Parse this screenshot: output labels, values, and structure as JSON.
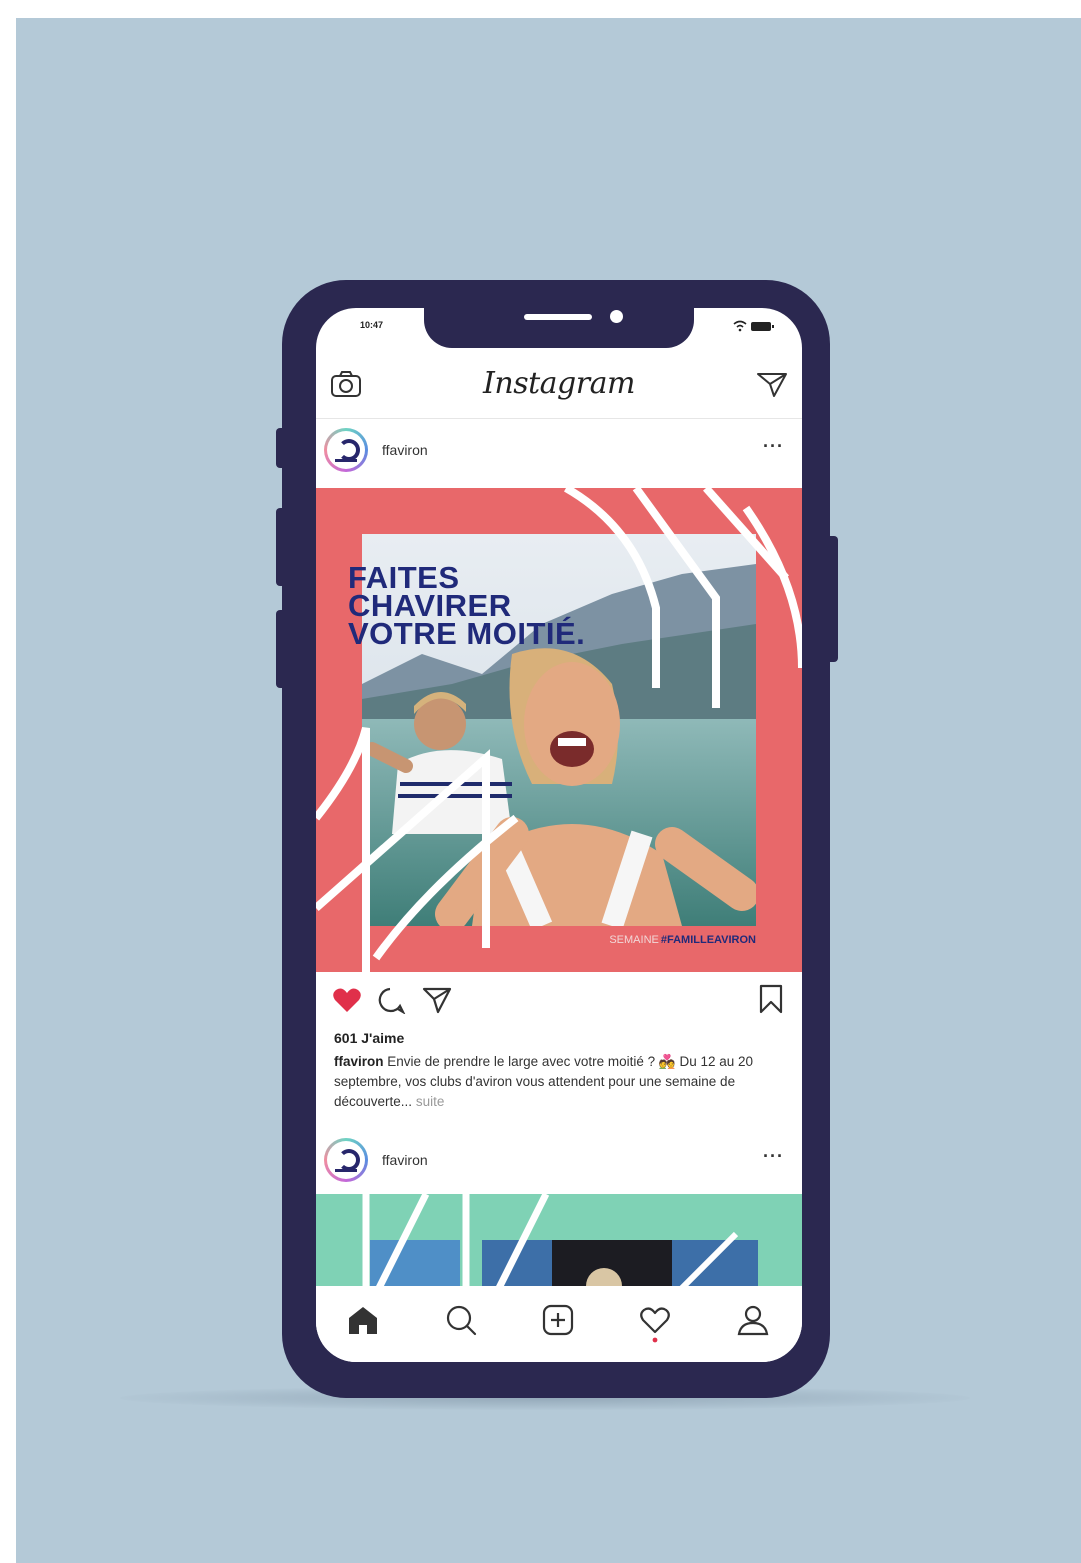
{
  "status_bar": {
    "time": "10:47"
  },
  "app": {
    "title": "Instagram"
  },
  "posts": [
    {
      "username": "ffaviron",
      "image": {
        "headline_lines": [
          "FAITES",
          "CHAVIRER",
          "VOTRE MOITIÉ."
        ],
        "tag_prefix": "SEMAINE",
        "tag": "#FAMILLEAVIRON"
      },
      "likes": "601 J'aime",
      "caption_user": "ffaviron",
      "caption_text": "Envie de prendre le large avec votre moitié ? 💑 Du 12 au 20 septembre, vos clubs d'aviron vous attendent pour une semaine de découverte...",
      "more_label": "suite",
      "liked": true
    },
    {
      "username": "ffaviron"
    }
  ],
  "tabbar": {
    "items": [
      {
        "icon": "home-icon",
        "active": true
      },
      {
        "icon": "search-icon"
      },
      {
        "icon": "add-post-icon"
      },
      {
        "icon": "activity-heart-icon",
        "notification_dot": true
      },
      {
        "icon": "profile-icon"
      }
    ]
  },
  "colors": {
    "background": "#b4c9d7",
    "phone_frame": "#2b2850",
    "post_accent": "#e8686a",
    "second_post_accent": "#7fd2b5",
    "headline": "#202a7a",
    "like_red": "#e0304a"
  }
}
